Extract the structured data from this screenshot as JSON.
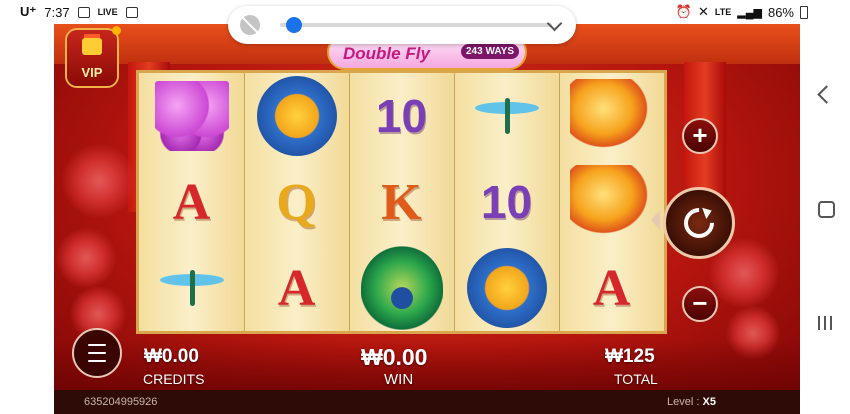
{
  "status_bar": {
    "carrier": "U⁺",
    "time": "7:37",
    "live_badge": "LIVE",
    "network": "LTE",
    "battery": "86%"
  },
  "media_control": {
    "icons": [
      "mute-icon",
      "chevron-down-icon"
    ],
    "progress": 0.05
  },
  "game": {
    "title": "Double Fly",
    "ways": "243 WAYS",
    "vip_label": "VIP",
    "reels": [
      [
        "butterfly",
        "A",
        "dragonfly"
      ],
      [
        "lotus",
        "Q",
        "A"
      ],
      [
        "10",
        "K",
        "peacock"
      ],
      [
        "dragonfly",
        "10",
        "lotus"
      ],
      [
        "bird",
        "bird",
        "A"
      ]
    ],
    "symbol_colors": {
      "A": "#d6282a",
      "Q": "#e8a91c",
      "K": "#e05a1a",
      "10": "#7b3fb5"
    },
    "controls": {
      "plus": "+",
      "minus": "−",
      "spin_icon": "spin-refresh-icon",
      "menu_icon": "menu-icon"
    },
    "credits": {
      "value": "₩0.00",
      "label": "CREDITS"
    },
    "win": {
      "value": "₩0.00",
      "label": "WIN"
    },
    "total": {
      "value": "₩125",
      "label": "TOTAL"
    },
    "footer": {
      "session_id": "635204995926",
      "level_label": "Level :",
      "level_value": "X5"
    }
  },
  "colors": {
    "background_red": "#b5150e",
    "reel_bg": "#f4dfa0",
    "frame_gold": "#d9a64d",
    "accent_blue": "#1a73e8"
  }
}
